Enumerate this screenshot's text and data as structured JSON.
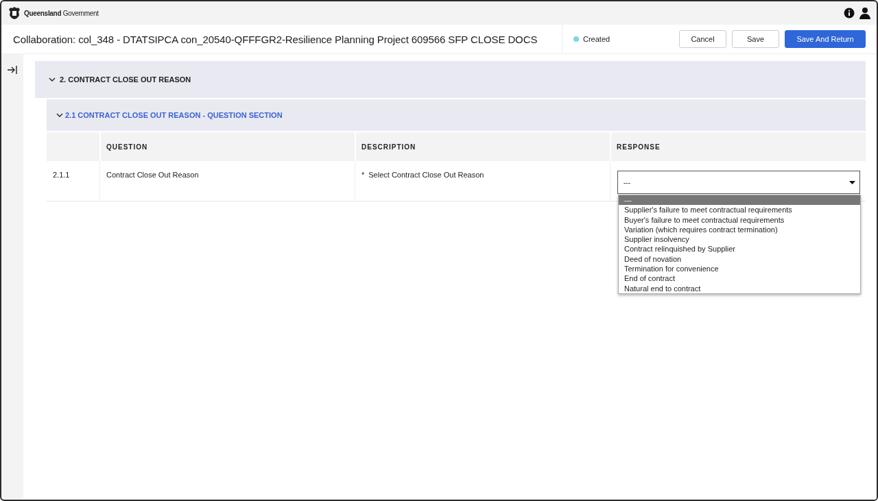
{
  "header": {
    "logo_text": "Queensland",
    "logo_subtext": "Government"
  },
  "title_bar": {
    "title": "Collaboration: col_348 - DTATSIPCA con_20540-QFFFGR2-Resilience Planning Project 609566 SFP CLOSE DOCS",
    "status": {
      "label": "Created",
      "color": "#7fd8d8"
    },
    "buttons": [
      {
        "label": "Cancel",
        "kind": "secondary"
      },
      {
        "label": "Save",
        "kind": "secondary"
      },
      {
        "label": "Save And Return",
        "kind": "primary"
      }
    ]
  },
  "section": {
    "title": "2. CONTRACT CLOSE OUT REASON",
    "expanded": true,
    "subsection": {
      "title": "2.1 CONTRACT CLOSE OUT REASON - QUESTION SECTION",
      "expanded": true,
      "table": {
        "columns": [
          "QUESTION",
          "DESCRIPTION",
          "RESPONSE"
        ],
        "rows": [
          {
            "number": "2.1.1",
            "question": "Contract Close Out Reason",
            "required_mark": "*",
            "description": "Select Contract Close Out Reason",
            "response": {
              "value": "---",
              "expanded": true,
              "options": [
                {
                  "label": "---",
                  "selected": true
                },
                {
                  "label": "Supplier's failure to meet contractual requirements",
                  "selected": false
                },
                {
                  "label": "Buyer's failure to meet contractual requirements",
                  "selected": false
                },
                {
                  "label": "Variation (which requires contract termination)",
                  "selected": false
                },
                {
                  "label": "Supplier insolvency",
                  "selected": false
                },
                {
                  "label": "Contract relinquished by Supplier",
                  "selected": false
                },
                {
                  "label": "Deed of novation",
                  "selected": false
                },
                {
                  "label": "Termination for convenience",
                  "selected": false
                },
                {
                  "label": "End of contract",
                  "selected": false
                },
                {
                  "label": "Natural end to contract",
                  "selected": false
                }
              ]
            }
          }
        ]
      }
    }
  }
}
